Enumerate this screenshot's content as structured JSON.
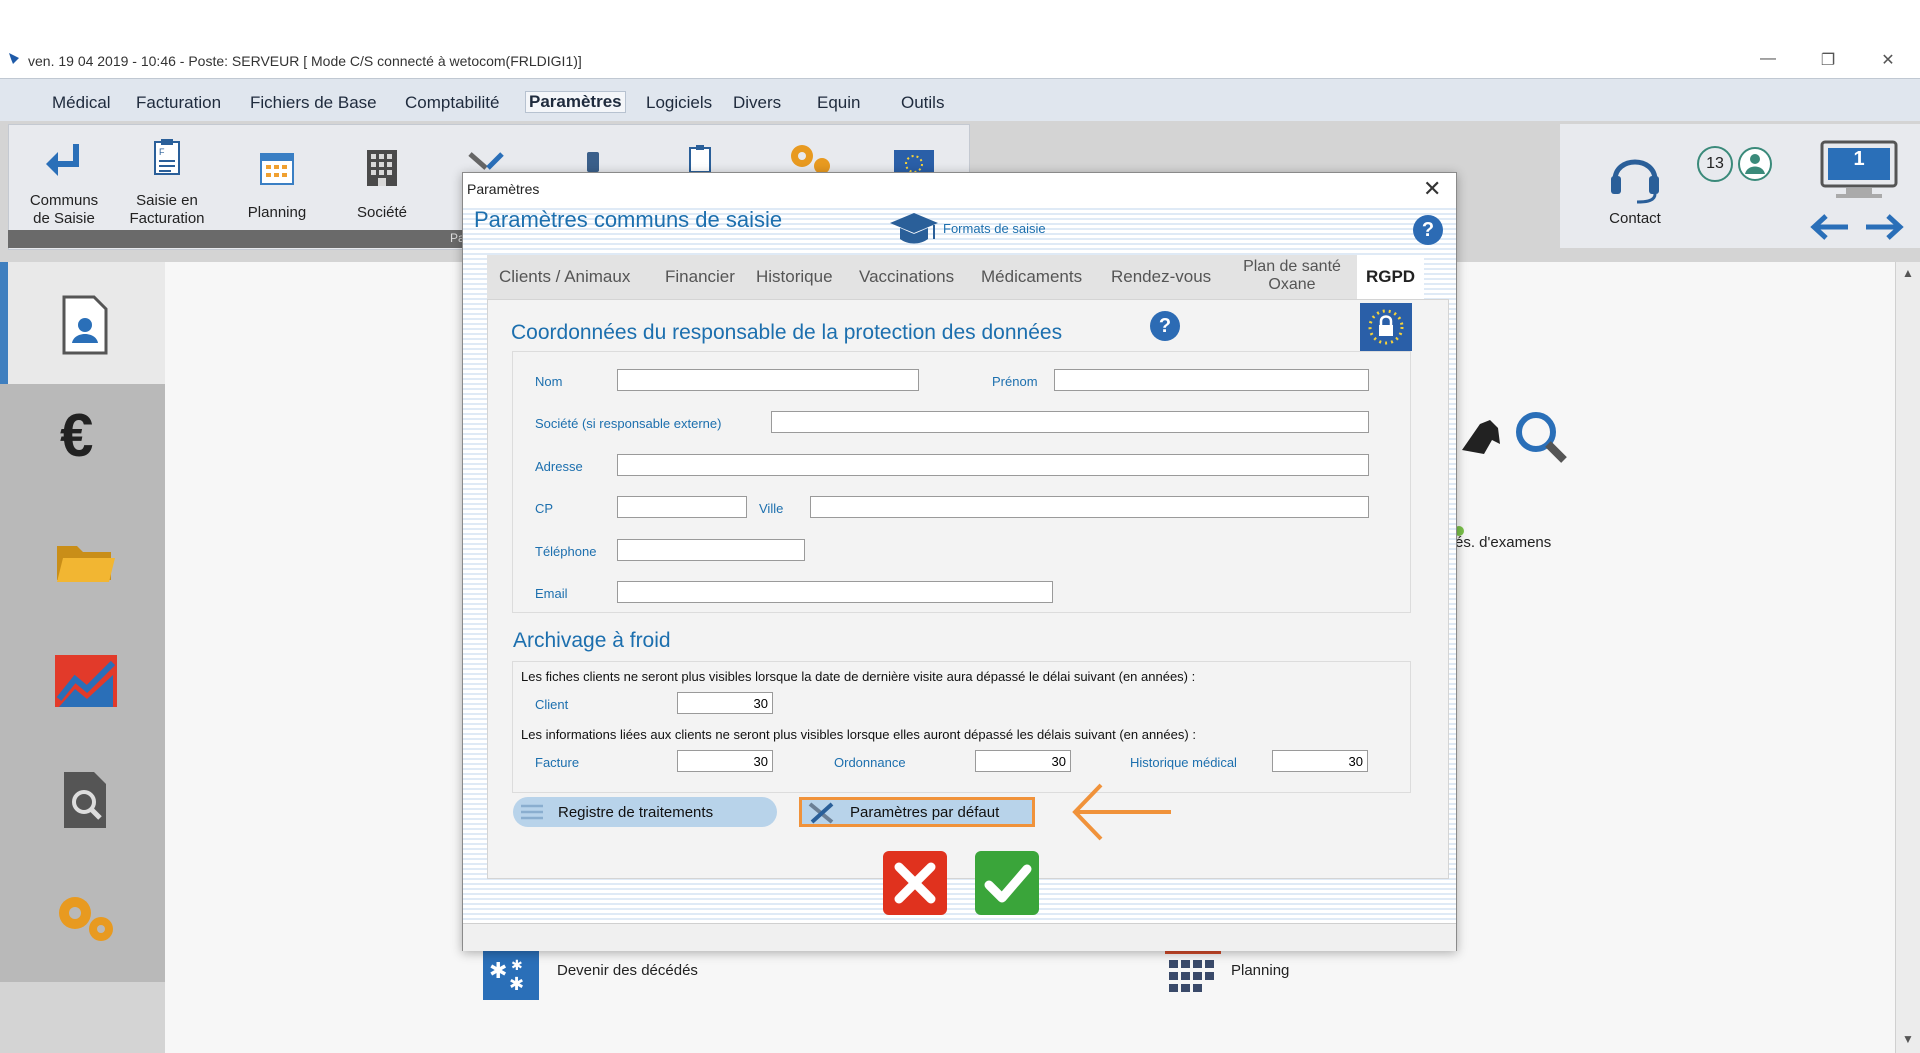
{
  "window": {
    "title": "ven. 19 04 2019 - 10:46 - Poste: SERVEUR  [ Mode C/S connecté à wetocom(FRLDIGI1)]"
  },
  "menu": {
    "items": [
      "Médical",
      "Facturation",
      "Fichiers de Base",
      "Comptabilité",
      "Paramètres",
      "Logiciels",
      "Divers",
      "Equin",
      "Outils"
    ],
    "active": "Paramètres"
  },
  "toolbar": {
    "communs_l1": "Communs",
    "communs_l2": "de Saisie",
    "facturation_l1": "Saisie en",
    "facturation_l2": "Facturation",
    "planning": "Planning",
    "societe": "Société",
    "strip_text": "Pa"
  },
  "right_toolbar": {
    "contact": "Contact",
    "badge_count": "13",
    "monitor_number": "1"
  },
  "background": {
    "examens": "és. d'examens",
    "deces": "Devenir des décédés",
    "planning": "Planning"
  },
  "dialog": {
    "title": "Paramètres",
    "heading": "Paramètres communs  de saisie",
    "formats_link": "Formats de saisie",
    "help": "?",
    "tabs": [
      "Clients / Animaux",
      "Financier",
      "Historique",
      "Vaccinations",
      "Médicaments",
      "Rendez-vous",
      "Plan de santé",
      "Oxane",
      "RGPD"
    ],
    "active_tab": "RGPD",
    "rgpd": {
      "section_title": "Coordonnées du responsable de la protection des données",
      "fields": {
        "nom": {
          "label": "Nom",
          "value": ""
        },
        "prenom": {
          "label": "Prénom",
          "value": ""
        },
        "societe": {
          "label": "Société (si responsable externe)",
          "value": ""
        },
        "adresse": {
          "label": "Adresse",
          "value": ""
        },
        "cp": {
          "label": "CP",
          "value": ""
        },
        "ville": {
          "label": "Ville",
          "value": ""
        },
        "telephone": {
          "label": "Téléphone",
          "value": ""
        },
        "email": {
          "label": "Email",
          "value": ""
        }
      },
      "archivage_title": "Archivage à froid",
      "sentence1": "Les fiches clients ne seront plus visibles lorsque la date de dernière visite aura dépassé le délai suivant (en années) :",
      "client": {
        "label": "Client",
        "value": "30"
      },
      "sentence2": "Les informations liées aux clients ne seront plus visibles lorsque elles auront dépassé les délais suivant (en années) :",
      "facture": {
        "label": "Facture",
        "value": "30"
      },
      "ordonnance": {
        "label": "Ordonnance",
        "value": "30"
      },
      "historique": {
        "label": "Historique médical",
        "value": "30"
      },
      "registre_button": "Registre de traitements",
      "defaut_button": "Paramètres par défaut"
    }
  },
  "colors": {
    "accent": "#1c6fae",
    "highlight": "#f0923a",
    "cancel": "#e0321e",
    "ok": "#3aa53a"
  }
}
